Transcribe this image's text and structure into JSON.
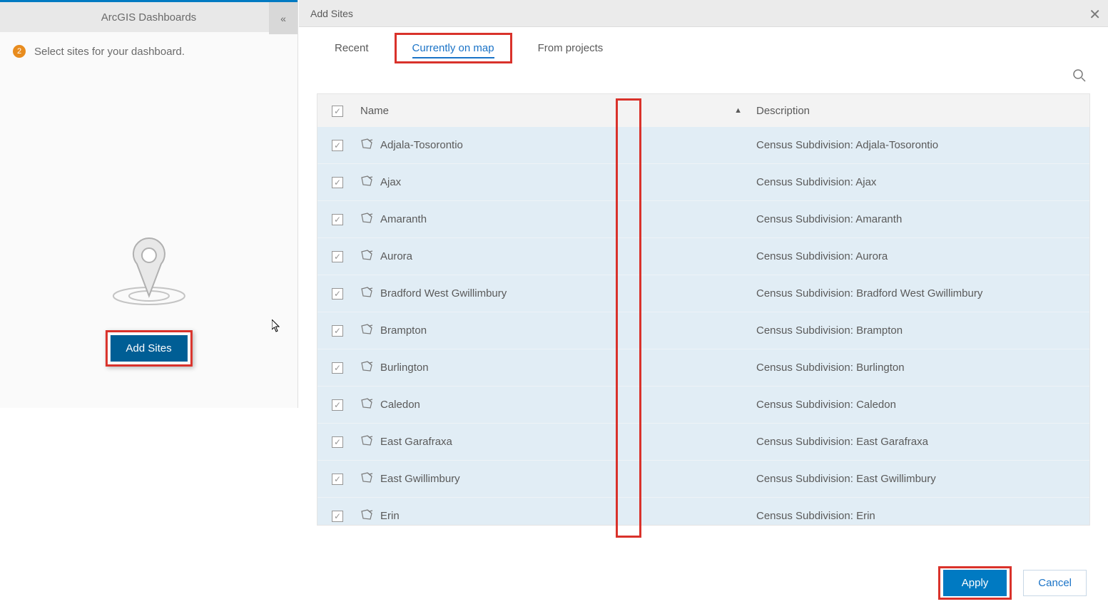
{
  "left": {
    "title": "ArcGIS Dashboards",
    "stepNumber": "2",
    "stepText": "Select sites for your dashboard.",
    "addSitesButton": "Add Sites"
  },
  "dialog": {
    "title": "Add Sites",
    "tabs": {
      "recent": "Recent",
      "currentlyOnMap": "Currently on map",
      "fromProjects": "From projects"
    },
    "columns": {
      "name": "Name",
      "description": "Description"
    },
    "rows": [
      {
        "name": "Adjala-Tosorontio",
        "desc": "Census Subdivision: Adjala-Tosorontio"
      },
      {
        "name": "Ajax",
        "desc": "Census Subdivision: Ajax"
      },
      {
        "name": "Amaranth",
        "desc": "Census Subdivision: Amaranth"
      },
      {
        "name": "Aurora",
        "desc": "Census Subdivision: Aurora"
      },
      {
        "name": "Bradford West Gwillimbury",
        "desc": "Census Subdivision: Bradford West Gwillimbury"
      },
      {
        "name": "Brampton",
        "desc": "Census Subdivision: Brampton"
      },
      {
        "name": "Burlington",
        "desc": "Census Subdivision: Burlington"
      },
      {
        "name": "Caledon",
        "desc": "Census Subdivision: Caledon"
      },
      {
        "name": "East Garafraxa",
        "desc": "Census Subdivision: East Garafraxa"
      },
      {
        "name": "East Gwillimbury",
        "desc": "Census Subdivision: East Gwillimbury"
      },
      {
        "name": "Erin",
        "desc": "Census Subdivision: Erin"
      }
    ],
    "footer": {
      "apply": "Apply",
      "cancel": "Cancel"
    }
  }
}
